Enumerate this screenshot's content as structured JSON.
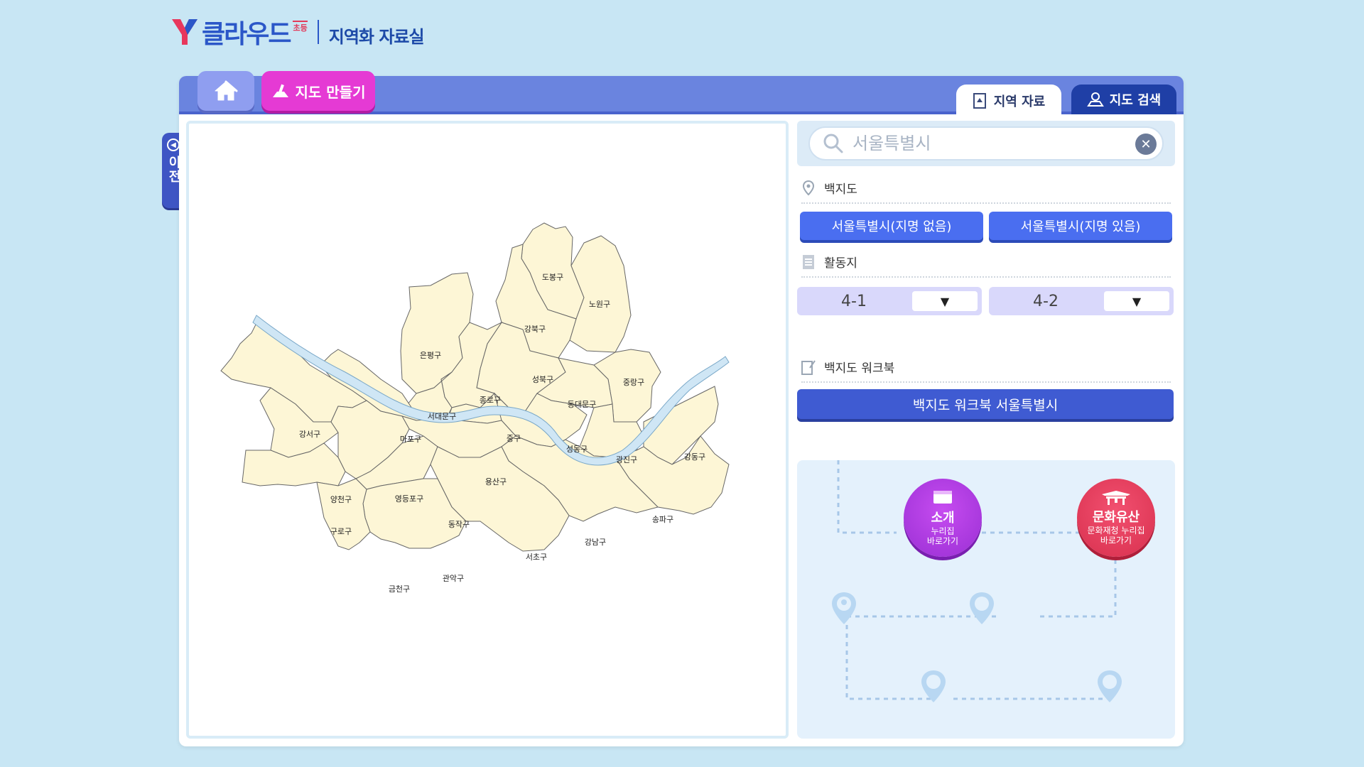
{
  "brand": {
    "name": "클라우드",
    "badge": "초등",
    "subtitle": "지역화 자료실",
    "color": "#2b57c8"
  },
  "header": {
    "home_icon": "home-icon",
    "make_map_label": "지도 만들기",
    "tabs": [
      {
        "label": "지역 자료",
        "active": true
      },
      {
        "label": "지도 검색",
        "active": false
      }
    ]
  },
  "side": {
    "prev_label": "이전"
  },
  "search": {
    "placeholder": "서울특별시",
    "value": ""
  },
  "sections": {
    "blank_map": {
      "title": "백지도",
      "buttons": [
        "서울특별시(지명 없음)",
        "서울특별시(지명 있음)"
      ]
    },
    "activity": {
      "title": "활동지",
      "selects": [
        {
          "value": "4-1",
          "arrow": "▼"
        },
        {
          "value": "4-2",
          "arrow": "▼"
        }
      ]
    },
    "workbook": {
      "title": "백지도 워크북",
      "button": "백지도 워크북 서울특별시"
    }
  },
  "route": {
    "intro": {
      "title": "소개",
      "sub1": "누리집",
      "sub2": "바로가기",
      "color": "#b03de4"
    },
    "heritage": {
      "title": "문화유산",
      "sub1": "문화재청 누리집",
      "sub2": "바로가기",
      "color": "#e8375c"
    }
  },
  "map": {
    "districts": [
      "도봉구",
      "노원구",
      "강북구",
      "은평구",
      "성북구",
      "중랑구",
      "종로구",
      "서대문구",
      "동대문구",
      "강서구",
      "마포구",
      "중구",
      "성동구",
      "광진구",
      "강동구",
      "용산구",
      "양천구",
      "영등포구",
      "동작구",
      "송파구",
      "구로구",
      "강남구",
      "서초구",
      "관악구",
      "금천구"
    ]
  }
}
